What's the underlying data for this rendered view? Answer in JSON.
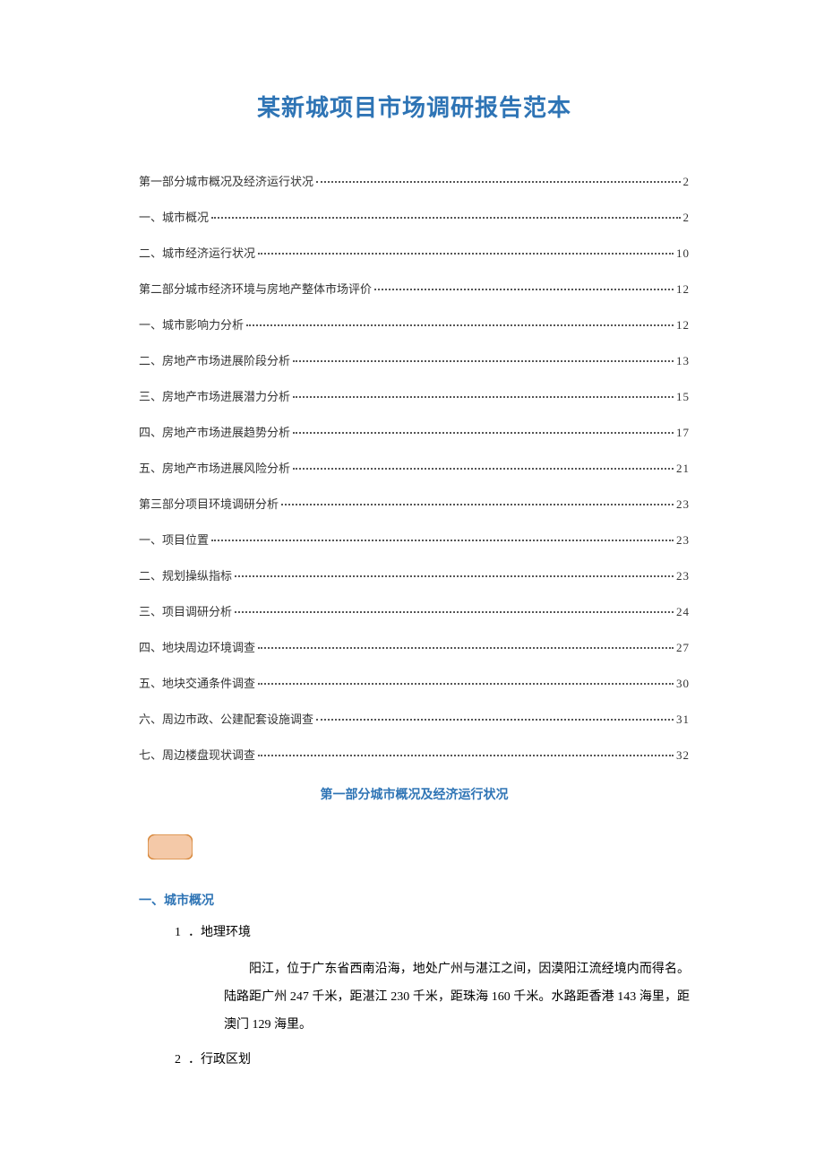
{
  "title": "某新城项目市场调研报告范本",
  "toc": [
    {
      "label": "第一部分城市概况及经济运行状况",
      "page": "2"
    },
    {
      "label": "一、城市概况",
      "page": "2"
    },
    {
      "label": "二、城市经济运行状况",
      "page": "10"
    },
    {
      "label": "第二部分城市经济环境与房地产整体市场评价",
      "page": "12"
    },
    {
      "label": "一、城市影响力分析",
      "page": "12"
    },
    {
      "label": "二、房地产市场进展阶段分析",
      "page": "13"
    },
    {
      "label": "三、房地产市场进展潜力分析",
      "page": "15"
    },
    {
      "label": "四、房地产市场进展趋势分析",
      "page": "17"
    },
    {
      "label": "五、房地产市场进展风险分析",
      "page": "21"
    },
    {
      "label": "第三部分项目环境调研分析",
      "page": "23"
    },
    {
      "label": "一、项目位置",
      "page": "23"
    },
    {
      "label": "二、规划操纵指标",
      "page": "23"
    },
    {
      "label": "三、项目调研分析",
      "page": "24"
    },
    {
      "label": "四、地块周边环境调查",
      "page": "27"
    },
    {
      "label": "五、地块交通条件调查",
      "page": "30"
    },
    {
      "label": "六、周边市政、公建配套设施调查",
      "page": "31"
    },
    {
      "label": "七、周边楼盘现状调查",
      "page": "32"
    }
  ],
  "section_heading": "第一部分城市概况及经济运行状况",
  "sub_heading": "一、城市概况",
  "item1": {
    "num": "1",
    "label": "．地理环境"
  },
  "item1_body": "阳江，位于广东省西南沿海，地处广州与湛江之间，因漠阳江流经境内而得名。陆路距广州 247 千米，距湛江 230 千米，距珠海 160 千米。水路距香港 143 海里，距澳门 129 海里。",
  "item2": {
    "num": "2",
    "label": "．行政区划"
  }
}
